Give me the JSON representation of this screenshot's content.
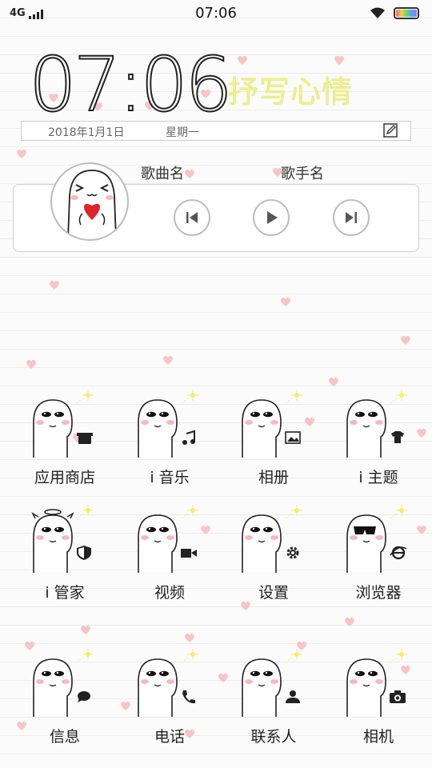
{
  "status_bar": {
    "network": "4G",
    "time": "07:06",
    "wifi_icon": "wifi-icon",
    "battery_icon": "battery-icon"
  },
  "clock": {
    "time": "07:06"
  },
  "mood": {
    "text": "抒写心情"
  },
  "date_bar": {
    "date": "2018年1月1日",
    "weekday": "星期一",
    "edit_icon": "edit-icon"
  },
  "music": {
    "song": "歌曲名",
    "singer": "歌手名",
    "controls": [
      "previous-icon",
      "play-icon",
      "next-icon"
    ]
  },
  "apps": [
    {
      "label": "应用商店",
      "icon": "store-icon"
    },
    {
      "label": "i 音乐",
      "icon": "music-note-icon"
    },
    {
      "label": "相册",
      "icon": "gallery-icon"
    },
    {
      "label": "i 主题",
      "icon": "shirt-icon"
    },
    {
      "label": "i 管家",
      "icon": "shield-icon"
    },
    {
      "label": "视频",
      "icon": "video-camera-icon"
    },
    {
      "label": "设置",
      "icon": "gear-icon"
    },
    {
      "label": "浏览器",
      "icon": "browser-icon"
    },
    {
      "label": "信息",
      "icon": "message-icon"
    },
    {
      "label": "电话",
      "icon": "phone-icon"
    },
    {
      "label": "联系人",
      "icon": "contact-icon"
    },
    {
      "label": "相机",
      "icon": "camera-icon"
    }
  ],
  "colors": {
    "heart": "#f9c4c6",
    "mood_text": "#f0f28a",
    "line": "#ececec",
    "text": "#222222"
  }
}
